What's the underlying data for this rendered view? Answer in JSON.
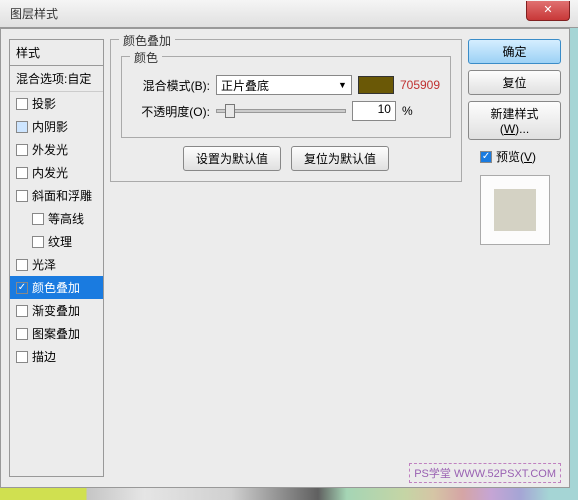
{
  "dialog": {
    "title": "图层样式"
  },
  "styles": {
    "header": "样式",
    "subhead": "混合选项:自定",
    "items": [
      {
        "label": "投影",
        "checked": false,
        "indent": false,
        "active": false
      },
      {
        "label": "内阴影",
        "checked": false,
        "indent": false,
        "active": false,
        "blue": true
      },
      {
        "label": "外发光",
        "checked": false,
        "indent": false,
        "active": false
      },
      {
        "label": "内发光",
        "checked": false,
        "indent": false,
        "active": false
      },
      {
        "label": "斜面和浮雕",
        "checked": false,
        "indent": false,
        "active": false
      },
      {
        "label": "等高线",
        "checked": false,
        "indent": true,
        "active": false
      },
      {
        "label": "纹理",
        "checked": false,
        "indent": true,
        "active": false
      },
      {
        "label": "光泽",
        "checked": false,
        "indent": false,
        "active": false
      },
      {
        "label": "颜色叠加",
        "checked": true,
        "indent": false,
        "active": true
      },
      {
        "label": "渐变叠加",
        "checked": false,
        "indent": false,
        "active": false
      },
      {
        "label": "图案叠加",
        "checked": false,
        "indent": false,
        "active": false
      },
      {
        "label": "描边",
        "checked": false,
        "indent": false,
        "active": false
      }
    ]
  },
  "panel": {
    "title": "颜色叠加",
    "group": "颜色",
    "blend_label": "混合模式(B):",
    "blend_value": "正片叠底",
    "color_hex": "705909",
    "opacity_label": "不透明度(O):",
    "opacity_value": "10",
    "opacity_unit": "%",
    "btn_default": "设置为默认值",
    "btn_reset": "复位为默认值"
  },
  "buttons": {
    "ok": "确定",
    "cancel": "复位",
    "new_style": "新建样式(W)...",
    "preview": "预览(V)"
  },
  "watermark": {
    "left": "PS学堂",
    "right": "WWW.52PSXT.COM"
  }
}
